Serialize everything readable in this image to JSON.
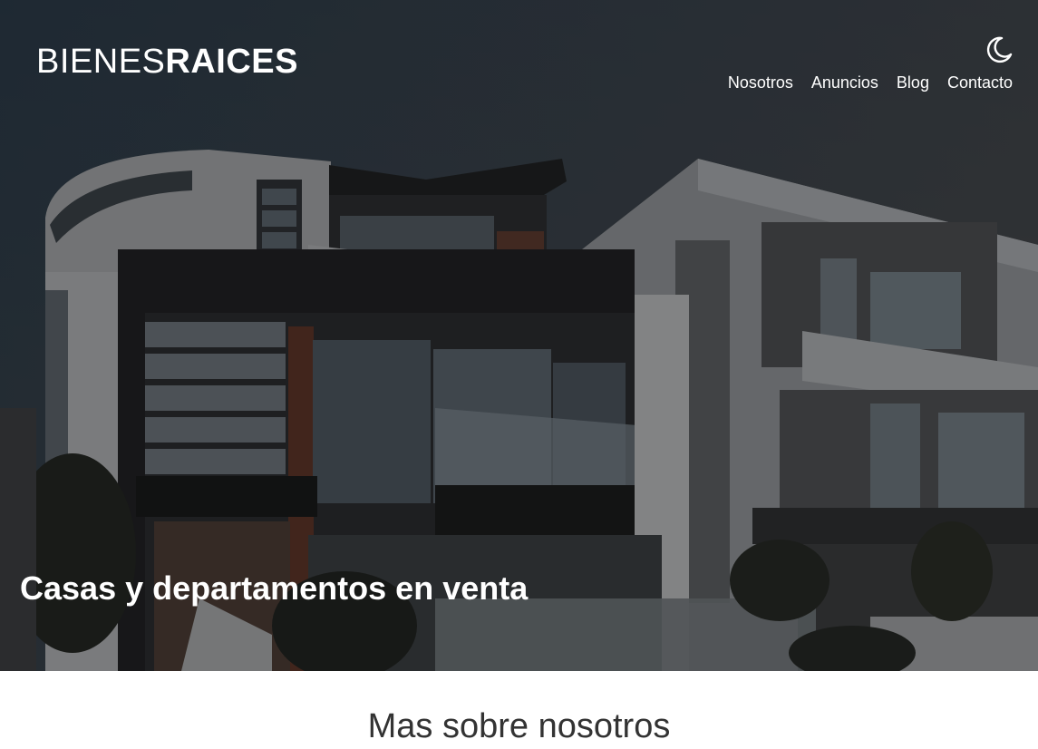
{
  "header": {
    "logo_light": "BIENES",
    "logo_bold": "RAICES",
    "theme_toggle_icon": "moon-icon",
    "nav": [
      {
        "label": "Nosotros"
      },
      {
        "label": "Anuncios"
      },
      {
        "label": "Blog"
      },
      {
        "label": "Contacto"
      }
    ]
  },
  "hero": {
    "title": "Casas y departamentos en venta",
    "image": "modern-house-photo"
  },
  "about": {
    "title": "Mas sobre nosotros"
  },
  "colors": {
    "text_light": "#ffffff",
    "text_dark": "#333333"
  }
}
